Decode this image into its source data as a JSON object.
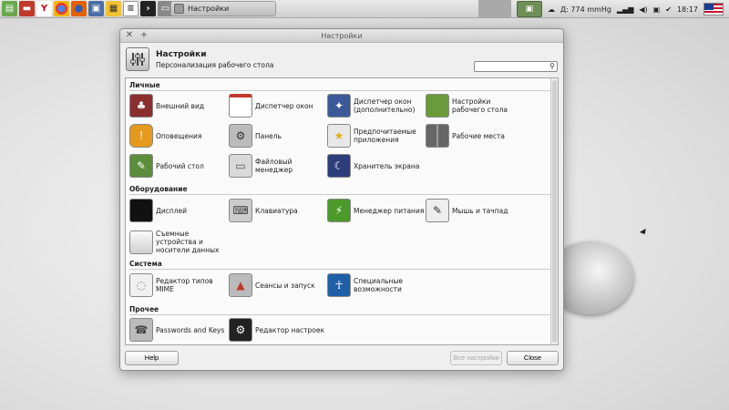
{
  "taskbar": {
    "window_button_label": "Настройки",
    "weather": "Д: 774 mmHg",
    "clock": "18:17"
  },
  "window": {
    "title": "Настройки",
    "header_title": "Настройки",
    "header_subtitle": "Персонализация рабочего стола",
    "search_placeholder": "",
    "footer": {
      "help": "Help",
      "all_settings": "Все настройки",
      "close": "Close"
    }
  },
  "sections": [
    {
      "title": "Личные",
      "items": [
        {
          "label": "Внешний вид",
          "icon": "appearance-icon"
        },
        {
          "label": "Диспетчер окон",
          "icon": "window-manager-icon"
        },
        {
          "label": "Диспетчер окон (дополнительно)",
          "icon": "window-manager-advanced-icon"
        },
        {
          "label": "Настройки рабочего стола",
          "icon": "desktop-settings-icon"
        },
        {
          "label": "Оповещения",
          "icon": "notifications-icon"
        },
        {
          "label": "Панель",
          "icon": "panel-icon"
        },
        {
          "label": "Предпочитаемые приложения",
          "icon": "preferred-apps-icon"
        },
        {
          "label": "Рабочие места",
          "icon": "workspaces-icon"
        },
        {
          "label": "Рабочий стол",
          "icon": "desktop-icon"
        },
        {
          "label": "Файловый менеджер",
          "icon": "file-manager-icon"
        },
        {
          "label": "Хранитель экрана",
          "icon": "screensaver-icon"
        }
      ]
    },
    {
      "title": "Оборудование",
      "items": [
        {
          "label": "Дисплей",
          "icon": "display-icon"
        },
        {
          "label": "Клавиатура",
          "icon": "keyboard-icon"
        },
        {
          "label": "Менеджер питания",
          "icon": "power-manager-icon"
        },
        {
          "label": "Мышь и тачпад",
          "icon": "mouse-touchpad-icon"
        },
        {
          "label": "Съемные устройства и носители данных",
          "icon": "removable-drives-icon"
        }
      ]
    },
    {
      "title": "Система",
      "items": [
        {
          "label": "Редактор типов MIME",
          "icon": "mime-editor-icon"
        },
        {
          "label": "Сеансы и запуск",
          "icon": "session-startup-icon"
        },
        {
          "label": "Специальные возможности",
          "icon": "accessibility-icon"
        }
      ]
    },
    {
      "title": "Прочее",
      "items": [
        {
          "label": "Passwords and Keys",
          "icon": "passwords-keys-icon"
        },
        {
          "label": "Редактор настроек",
          "icon": "settings-editor-icon"
        }
      ]
    }
  ]
}
